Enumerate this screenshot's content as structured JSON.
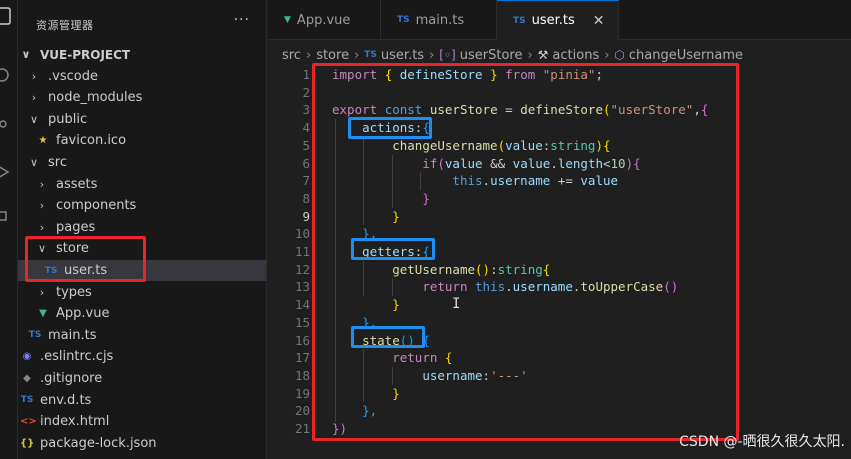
{
  "explorer": {
    "title": "资源管理器",
    "more": "···",
    "items": [
      {
        "label": "VUE-PROJECT",
        "kind": "root",
        "chev": "∨",
        "icon": ""
      },
      {
        "label": ".vscode",
        "kind": "folder",
        "chev": "›",
        "icon": ""
      },
      {
        "label": "node_modules",
        "kind": "folder",
        "chev": "›",
        "icon": ""
      },
      {
        "label": "public",
        "kind": "folder",
        "chev": "∨",
        "icon": ""
      },
      {
        "label": "favicon.ico",
        "kind": "file",
        "chev": "",
        "icon": "★"
      },
      {
        "label": "src",
        "kind": "folder",
        "chev": "∨",
        "icon": ""
      },
      {
        "label": "assets",
        "kind": "folder",
        "chev": "›",
        "icon": ""
      },
      {
        "label": "components",
        "kind": "folder",
        "chev": "›",
        "icon": ""
      },
      {
        "label": "pages",
        "kind": "folder",
        "chev": "›",
        "icon": ""
      },
      {
        "label": "store",
        "kind": "folder",
        "chev": "∨",
        "icon": ""
      },
      {
        "label": "user.ts",
        "kind": "file",
        "chev": "",
        "icon": "TS"
      },
      {
        "label": "types",
        "kind": "folder",
        "chev": "›",
        "icon": ""
      },
      {
        "label": "App.vue",
        "kind": "file",
        "chev": "",
        "icon": "▼"
      },
      {
        "label": "main.ts",
        "kind": "file",
        "chev": "",
        "icon": "TS"
      },
      {
        "label": ".eslintrc.cjs",
        "kind": "file",
        "chev": "",
        "icon": "◉"
      },
      {
        "label": ".gitignore",
        "kind": "file",
        "chev": "",
        "icon": "◆"
      },
      {
        "label": "env.d.ts",
        "kind": "file",
        "chev": "",
        "icon": "TS"
      },
      {
        "label": "index.html",
        "kind": "file",
        "chev": "",
        "icon": "<>"
      },
      {
        "label": "package-lock.json",
        "kind": "file",
        "chev": "",
        "icon": "{}"
      }
    ]
  },
  "tabs": [
    {
      "label": "App.vue",
      "icon": "▼"
    },
    {
      "label": "main.ts",
      "icon": "TS"
    },
    {
      "label": "user.ts",
      "icon": "TS",
      "close": "✕"
    }
  ],
  "breadcrumb": [
    "src",
    "store",
    "user.ts",
    "userStore",
    "actions",
    "changeUsername"
  ],
  "editor": {
    "line_numbers": [
      "1",
      "2",
      "3",
      "4",
      "5",
      "6",
      "7",
      "8",
      "9",
      "10",
      "11",
      "12",
      "13",
      "14",
      "15",
      "16",
      "17",
      "18",
      "19",
      "20",
      "21"
    ],
    "current_line": "9",
    "code": {
      "l1_import": "import",
      "l1_open": "{",
      "l1_name": "defineStore",
      "l1_close": "}",
      "l1_from": "from",
      "l1_src": "\"pinia\"",
      "l1_semi": ";",
      "l3_export": "export",
      "l3_const": "const",
      "l3_var": "userStore",
      "l3_eq": "=",
      "l3_fn": "defineStore",
      "l3_paren": "(",
      "l3_id": "\"userStore\"",
      "l3_comma": ",",
      "l3_brace": "{",
      "l4_key": "actions",
      "l4_colon": ":",
      "l4_brace": "{",
      "l5_fn": "changeUsername",
      "l5_open": "(",
      "l5_param": "value",
      "l5_colon": ":",
      "l5_type": "string",
      "l5_close": ")",
      "l5_brace": "{",
      "l6_if": "if",
      "l6_open": "(",
      "l6_v1": "value",
      "l6_and": "&&",
      "l6_v2": "value",
      "l6_dot": ".",
      "l6_len": "length",
      "l6_lt": "<",
      "l6_num": "10",
      "l6_close": ")",
      "l6_brace": "{",
      "l7_this": "this",
      "l7_dot": ".",
      "l7_prop": "username",
      "l7_op": "+=",
      "l7_val": "value",
      "l8_brace": "}",
      "l9_brace": "}",
      "l10_close": "},",
      "l11_key": "getters",
      "l11_colon": ":",
      "l11_brace": "{",
      "l12_fn": "getUsername",
      "l12_parens": "()",
      "l12_colon": ":",
      "l12_type": "string",
      "l12_brace": "{",
      "l13_return": "return",
      "l13_this": "this",
      "l13_dot": ".",
      "l13_prop": "username",
      "l13_dot2": ".",
      "l13_fn": "toUpperCase",
      "l13_parens": "()",
      "l14_brace": "}",
      "l15_close": "},",
      "l16_fn": "state",
      "l16_parens": "()",
      "l16_brace": "{",
      "l17_return": "return",
      "l17_brace": "{",
      "l18_key": "username",
      "l18_colon": ":",
      "l18_val": "'---'",
      "l19_brace": "}",
      "l20_close": "},",
      "l21_close": "})"
    }
  },
  "watermark": "CSDN @-晒很久很久太阳.",
  "colors": {
    "annotation_red": "#e8262a",
    "annotation_blue": "#1e8ff0",
    "accent": "#0078d4"
  }
}
